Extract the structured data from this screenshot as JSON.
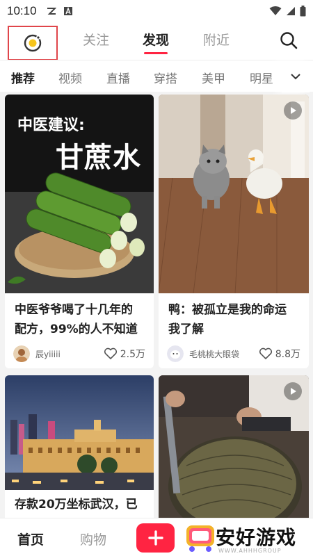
{
  "status_bar": {
    "time": "10:10"
  },
  "top_nav": {
    "tabs": [
      {
        "label": "关注",
        "active": false
      },
      {
        "label": "发现",
        "active": true
      },
      {
        "label": "附近",
        "active": false
      }
    ]
  },
  "categories": {
    "items": [
      {
        "label": "推荐",
        "active": true
      },
      {
        "label": "视频"
      },
      {
        "label": "直播"
      },
      {
        "label": "穿搭"
      },
      {
        "label": "美甲"
      },
      {
        "label": "明星"
      }
    ]
  },
  "feed": [
    {
      "title": "中医爷爷喝了十几年的配方，99%的人不知道",
      "title_line1": "中医爷爷喝了十几年的",
      "title_line2": "配方，99%的人不知道",
      "image_caption_small": "中医建议:",
      "image_caption_big": "甘蔗水",
      "author": "辰yiiiii",
      "likes": "2.5万",
      "is_video": false
    },
    {
      "title": "鸭：被孤立是我的命运我了解",
      "title_line1": "鸭：被孤立是我的命运",
      "title_line2": "我了解",
      "author": "毛桃桃大眼袋",
      "likes": "8.8万",
      "is_video": true
    },
    {
      "title": "存款20万坐标武汉，已",
      "title_line1": "存款20万坐标武汉，已",
      "is_video": false
    },
    {
      "is_video": true
    }
  ],
  "bottom_bar": {
    "tabs": [
      {
        "label": "首页",
        "active": true
      },
      {
        "label": "购物",
        "active": false
      }
    ],
    "add_label": "+"
  },
  "watermark": {
    "text": "安好游戏",
    "sub": "WWW.AHHHGROUP"
  },
  "colors": {
    "accent": "#ff2442",
    "highlight_box": "#e0454a"
  }
}
